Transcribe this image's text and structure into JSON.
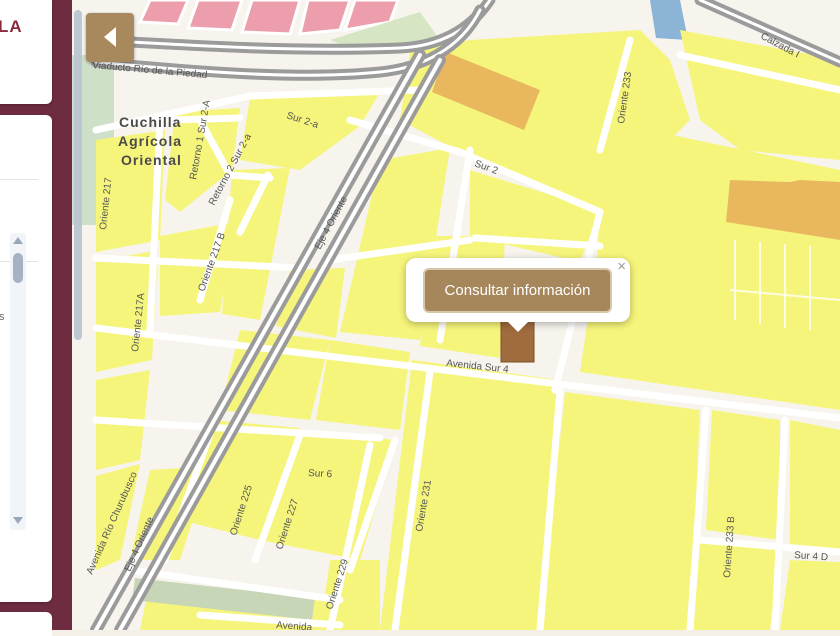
{
  "map": {
    "neighborhood": [
      "Cuchilla",
      "Agrícola",
      "Oriental"
    ],
    "streets": {
      "viaducto": "Viaducto Río de la Piedad",
      "calzada": "Calzada I",
      "sur2a": "Sur 2-a",
      "retorno1": "Retorno 1 Sur 2-A",
      "retorno2": "Retorno 2 Sur 2-a",
      "sur2": "Sur 2",
      "oriente217": "Oriente 217",
      "oriente217b": "Oriente 217 B",
      "oriente217a": "Oriente 217A",
      "eje4_upper": "Eje 4 Oriente",
      "eje4_lower": "Eje 4 Oriente",
      "oriente233": "Oriente 233",
      "avsur4": "Avenida Sur 4",
      "sur6": "Sur 6",
      "oriente225": "Oriente 225",
      "oriente227": "Oriente 227",
      "oriente229": "Oriente 229",
      "oriente231": "Oriente 231",
      "oriente233b": "Oriente 233 B",
      "sur4d": "Sur 4 D",
      "rio_churubusco": "Avenida Río Churubusco",
      "avenida_bottom": "Avenida"
    },
    "colors": {
      "block": "#f6f57b",
      "street": "#ffffff",
      "viaduct": "#9b9b9b",
      "commercial": "#e9b85e",
      "selected_parcel": "#a06b3d",
      "park": "#c6d6b6",
      "water": "#8bb4d6",
      "pink_block": "#ec9ead"
    }
  },
  "sidebar": {
    "top_title": "LA",
    "list_fragment": "s"
  },
  "popup": {
    "button_label": "Consultar información",
    "close_symbol": "×"
  }
}
